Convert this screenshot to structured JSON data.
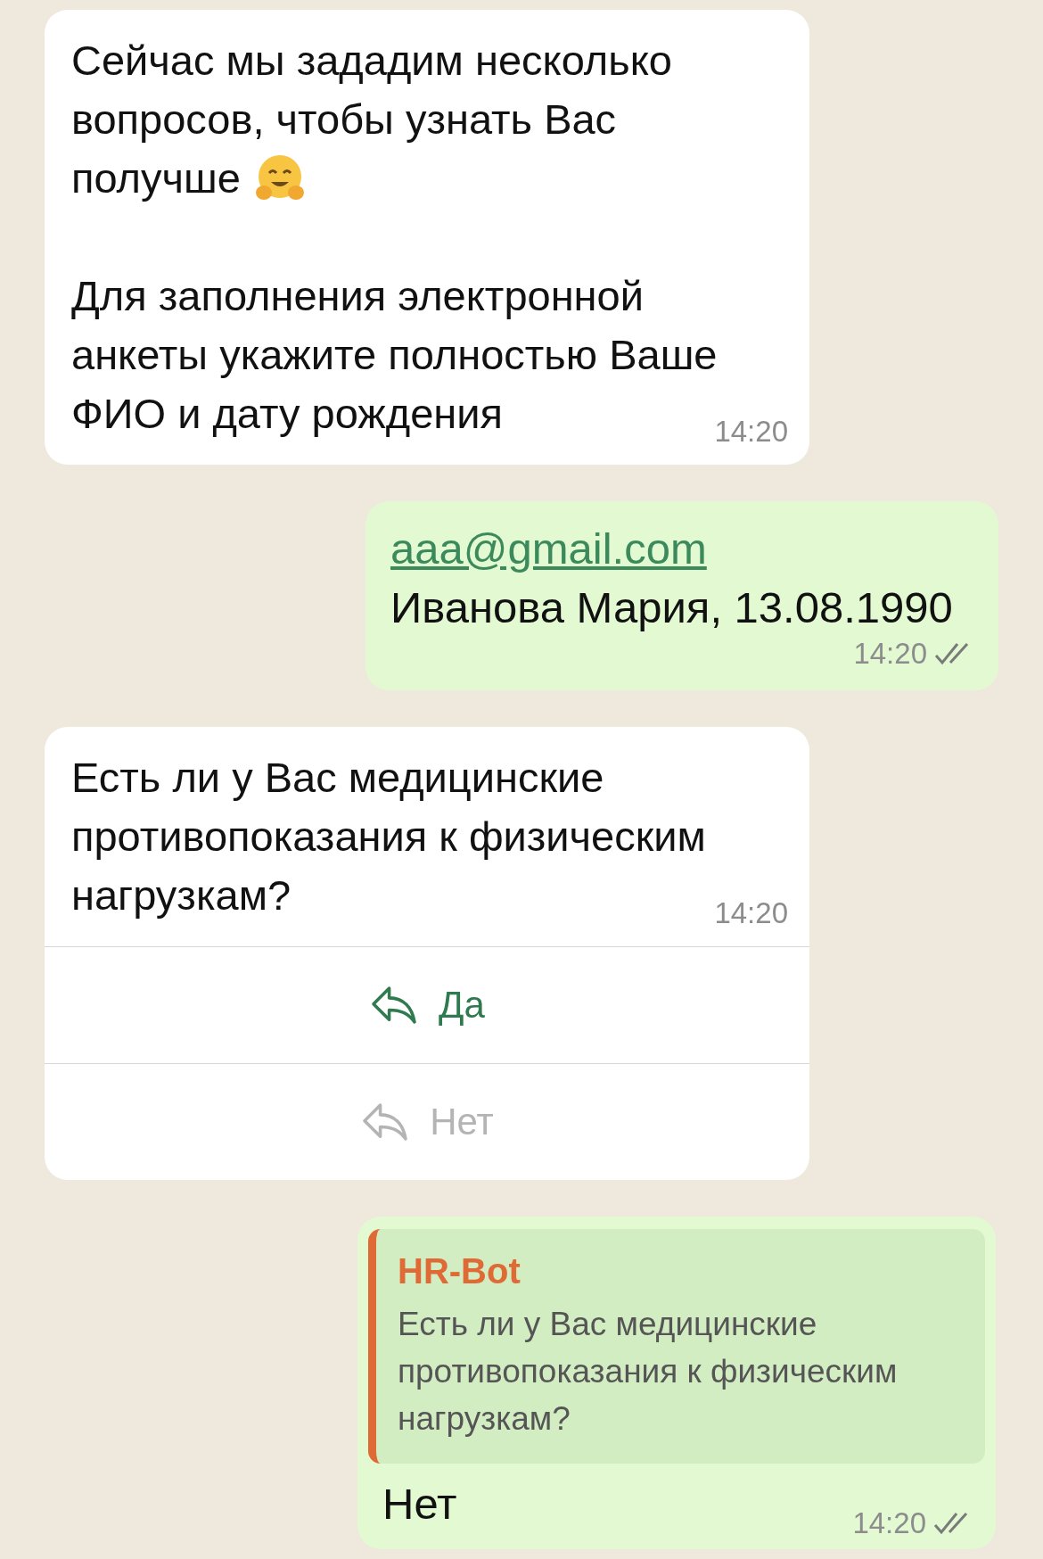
{
  "messages": [
    {
      "kind": "incoming",
      "paragraphs": [
        {
          "lines": [
            "Сейчас мы зададим несколько",
            "вопросов, чтобы узнать Вас",
            "получше"
          ],
          "has_emoji": true
        },
        {
          "lines": [
            "Для заполнения электронной",
            "анкеты укажите полностью Ваше",
            "ФИО и дату рождения"
          ],
          "has_emoji": false
        }
      ],
      "time": "14:20"
    },
    {
      "kind": "outgoing",
      "link": "aaa@gmail.com",
      "text": "Иванова Мария, 13.08.1990",
      "time": "14:20",
      "read": true
    },
    {
      "kind": "incoming",
      "paragraphs": [
        {
          "lines": [
            "Есть ли у Вас медицинские",
            "противопоказания к физическим",
            "нагрузкам?"
          ],
          "has_emoji": false
        }
      ],
      "time": "14:20",
      "quick_replies": [
        {
          "label": "Да",
          "disabled": false
        },
        {
          "label": "Нет",
          "disabled": true
        }
      ]
    },
    {
      "kind": "outgoing",
      "quote": {
        "author": "HR-Bot",
        "lines": [
          "Есть ли у Вас медицинские",
          "противопоказания к физическим",
          "нагрузкам?"
        ]
      },
      "text": "Нет",
      "time": "14:20",
      "read": true
    }
  ]
}
